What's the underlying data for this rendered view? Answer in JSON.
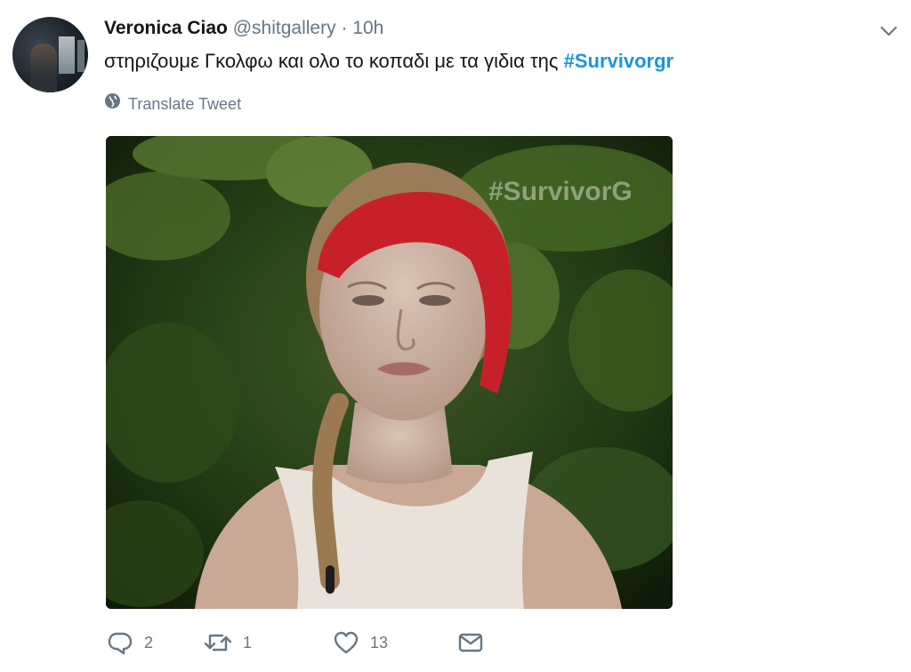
{
  "tweet": {
    "author_name": "Veronica Ciao",
    "handle": "@shitgallery",
    "separator": "·",
    "time": "10h",
    "text": "στηριζουμε Γκολφω και ολο το κοπαδι με τα γιδια της ",
    "hashtag": "#Survivorgr",
    "translate_label": "Translate Tweet",
    "media_watermark": "#SurvivorG"
  },
  "actions": {
    "reply_count": "2",
    "retweet_count": "1",
    "like_count": "13"
  },
  "icons": {
    "chevron": "chevron-down-icon",
    "globe": "globe-icon",
    "reply": "reply-icon",
    "retweet": "retweet-icon",
    "like": "heart-icon",
    "dm": "envelope-icon"
  },
  "colors": {
    "hashtag": "#1b95e0",
    "secondary_text": "#657786",
    "headband": "#c8202a"
  }
}
